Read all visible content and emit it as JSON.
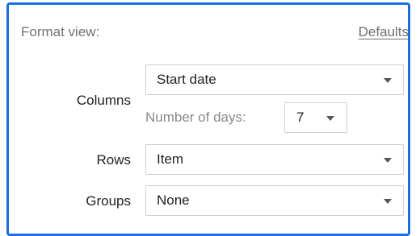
{
  "header": {
    "title": "Format view:",
    "defaults_label": "Defaults"
  },
  "columns": {
    "label": "Columns",
    "select_value": "Start date",
    "days_label": "Number of days:",
    "days_value": "7"
  },
  "rows": {
    "label": "Rows",
    "select_value": "Item"
  },
  "groups": {
    "label": "Groups",
    "select_value": "None"
  },
  "icons": {
    "dropdown": "chevron-down-icon"
  },
  "colors": {
    "frame_border": "#1a6ee0",
    "muted_text": "#707070"
  }
}
